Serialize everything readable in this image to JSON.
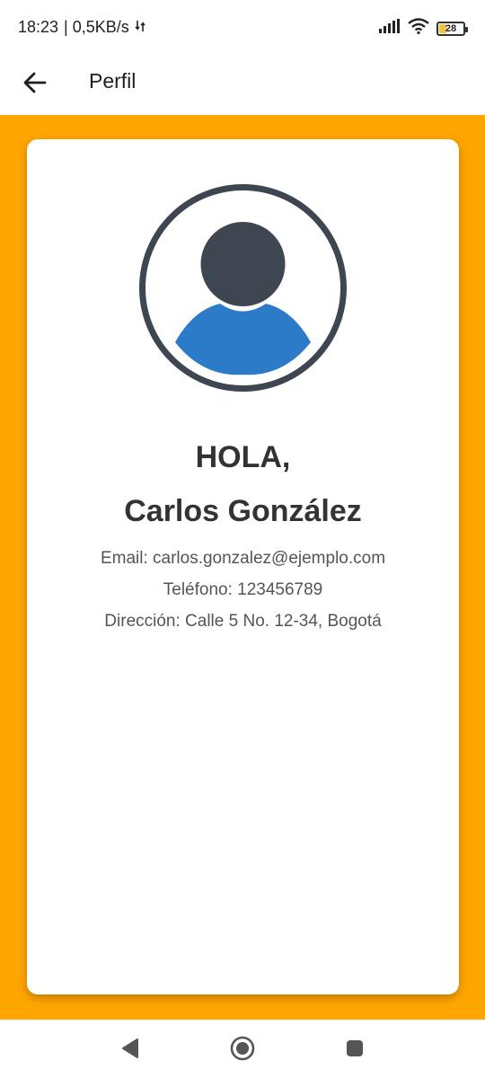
{
  "status_bar": {
    "time": "18:23",
    "network_speed": "| 0,5KB/s",
    "battery_level": "28",
    "icons": [
      "data-activity-icon",
      "signal-icon",
      "wifi-icon",
      "battery-icon"
    ]
  },
  "app_bar": {
    "title": "Perfil",
    "back_icon": "arrow-left-icon"
  },
  "colors": {
    "background_accent": "#ffa500",
    "avatar_dark": "#3d4651",
    "avatar_body": "#2b7bc9",
    "text_primary": "#333333",
    "text_secondary": "#555555"
  },
  "profile": {
    "greeting": "HOLA,",
    "name": "Carlos González",
    "email": "Email: carlos.gonzalez@ejemplo.com",
    "phone": "Teléfono: 123456789",
    "address": "Dirección: Calle 5 No. 12-34, Bogotá",
    "avatar_icon": "user-avatar-icon"
  },
  "nav_bar": {
    "icons": [
      "nav-back-icon",
      "nav-home-icon",
      "nav-recents-icon"
    ]
  }
}
